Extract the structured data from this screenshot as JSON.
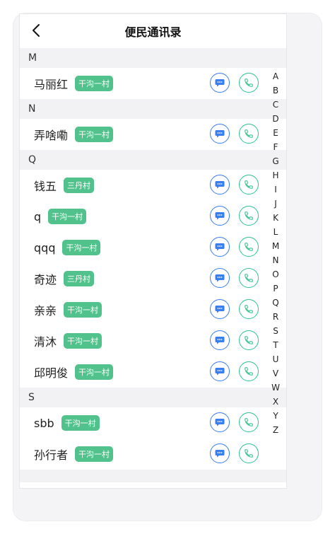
{
  "header": {
    "title": "便民通讯录"
  },
  "sections": [
    {
      "letter": "M",
      "contacts": [
        {
          "name": "马丽红",
          "tag": "干沟一村"
        }
      ]
    },
    {
      "letter": "N",
      "contacts": [
        {
          "name": "弄啥嘞",
          "tag": "干沟一村"
        }
      ]
    },
    {
      "letter": "Q",
      "contacts": [
        {
          "name": "钱五",
          "tag": "三丹村"
        },
        {
          "name": "q",
          "tag": "干沟一村"
        },
        {
          "name": "qqq",
          "tag": "干沟一村"
        },
        {
          "name": "奇迹",
          "tag": "三丹村"
        },
        {
          "name": "亲亲",
          "tag": "干沟一村"
        },
        {
          "name": "清沐",
          "tag": "干沟一村"
        },
        {
          "name": "邱明俊",
          "tag": "干沟一村"
        }
      ]
    },
    {
      "letter": "S",
      "contacts": [
        {
          "name": "sbb",
          "tag": "干沟一村"
        },
        {
          "name": "孙行者",
          "tag": "干沟一村"
        }
      ]
    }
  ],
  "index_letters": [
    "A",
    "B",
    "C",
    "D",
    "E",
    "F",
    "G",
    "H",
    "I",
    "J",
    "K",
    "L",
    "M",
    "N",
    "O",
    "P",
    "Q",
    "R",
    "S",
    "T",
    "U",
    "V",
    "W",
    "X",
    "Y",
    "Z"
  ],
  "icons": {
    "back": "chevron-left-icon",
    "message": "message-icon",
    "call": "phone-icon"
  },
  "colors": {
    "tag_bg": "#52c28c",
    "message_accent": "#3a7ff2",
    "call_accent": "#2ec28b",
    "section_bg": "#f2f2f4"
  }
}
